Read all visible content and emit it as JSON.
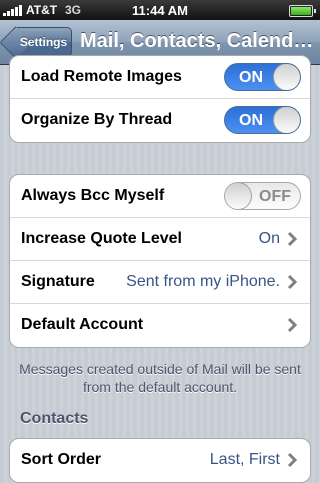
{
  "status_bar": {
    "carrier": "AT&T",
    "network": "3G",
    "time": "11:44 AM",
    "signal_icon": "signal-bars-icon",
    "battery_icon": "battery-icon"
  },
  "nav": {
    "back_label": "Settings",
    "title": "Mail, Contacts, Calend…"
  },
  "group1": {
    "rows": [
      {
        "label": "Load Remote Images",
        "toggle": "ON"
      },
      {
        "label": "Organize By Thread",
        "toggle": "ON"
      }
    ]
  },
  "group2": {
    "rows": [
      {
        "label": "Always Bcc Myself",
        "toggle": "OFF"
      },
      {
        "label": "Increase Quote Level",
        "value": "On"
      },
      {
        "label": "Signature",
        "value": "Sent from my iPhone."
      },
      {
        "label": "Default Account",
        "value": ""
      }
    ]
  },
  "footnote": "Messages created outside of Mail will be sent from the default account.",
  "contacts": {
    "header": "Contacts",
    "rows": [
      {
        "label": "Sort Order",
        "value": "Last, First"
      }
    ]
  },
  "colors": {
    "toggle_on": "#3b7fe3",
    "value_text": "#385487",
    "nav_bar": "#8ea2b9"
  }
}
